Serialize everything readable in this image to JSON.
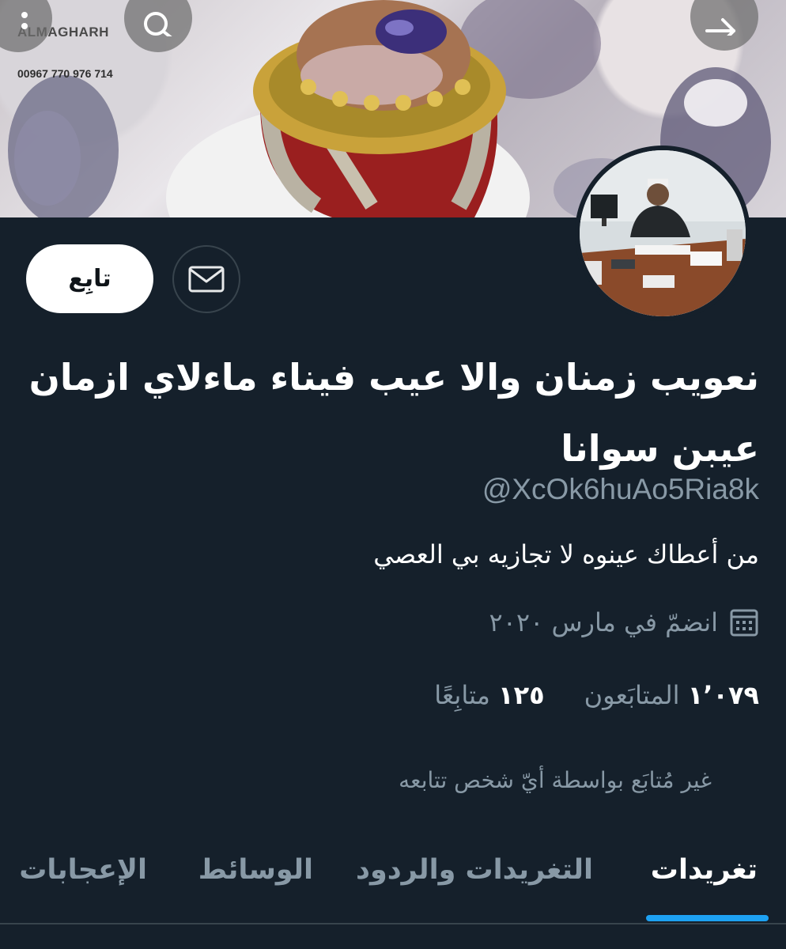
{
  "banner": {
    "watermark_name": "ALMAGHARH",
    "watermark_phone": "00967 770 976 714"
  },
  "header": {
    "more_icon": "more-vertical-icon",
    "search_icon": "search-icon",
    "back_icon": "arrow-right-icon"
  },
  "actions": {
    "message_icon": "envelope-icon",
    "follow_label": "تابِع"
  },
  "profile": {
    "display_name": "نعويب زمنان والا عيب فيناء ماءلاي ازمان عيبن سوانا",
    "handle": "@XcOk6huAo5Ria8k",
    "bio": "من أعطاك عينوه لا تجازيه بي العصي",
    "joined": "انضمّ في مارس ٢٠٢٠",
    "joined_icon": "calendar-icon"
  },
  "stats": {
    "followers_count": "١٬٠٧٩",
    "followers_label": "المتابَعون",
    "following_count": "١٢٥",
    "following_label": "متابِعًا"
  },
  "not_followed_text": "غير مُتابَع بواسطة أيّ شخص تتابعه",
  "tabs": [
    {
      "label": "تغريدات",
      "active": true
    },
    {
      "label": "التغريدات والردود",
      "active": false
    },
    {
      "label": "الوسائط",
      "active": false
    },
    {
      "label": "الإعجابات",
      "active": false
    }
  ],
  "colors": {
    "background": "#15202b",
    "secondary_text": "#8899a6",
    "accent": "#1da1f2",
    "border": "#38444d"
  }
}
